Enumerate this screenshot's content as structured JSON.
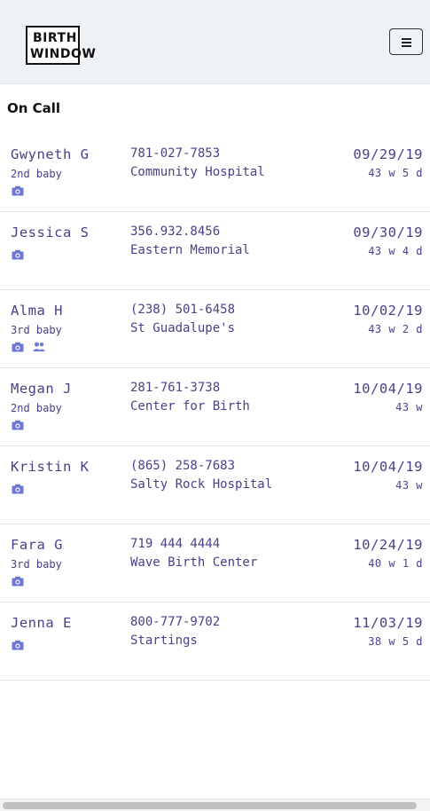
{
  "app": {
    "logo_line1": "BIRTH",
    "logo_line2": "WINDOW"
  },
  "page": {
    "title": "On Call"
  },
  "clients": [
    {
      "name": "Gwyneth G",
      "baby": "2nd baby",
      "phone": "781-027-7853",
      "place": "Community Hospital",
      "date": "09/29/19",
      "weeks": "43 w 5 d",
      "icons": [
        "camera-icon"
      ]
    },
    {
      "name": "Jessica S",
      "baby": "",
      "phone": "356.932.8456",
      "place": "Eastern Memorial",
      "date": "09/30/19",
      "weeks": "43 w 4 d",
      "icons": [
        "camera-icon"
      ]
    },
    {
      "name": "Alma H",
      "baby": "3rd baby",
      "phone": "(238) 501-6458",
      "place": "St Guadalupe's",
      "date": "10/02/19",
      "weeks": "43 w 2 d",
      "icons": [
        "camera-icon",
        "users-icon"
      ]
    },
    {
      "name": "Megan J",
      "baby": "2nd baby",
      "phone": "281-761-3738",
      "place": "Center for Birth",
      "date": "10/04/19",
      "weeks": "43 w",
      "icons": [
        "camera-icon"
      ]
    },
    {
      "name": "Kristin K",
      "baby": "",
      "phone": "(865) 258-7683",
      "place": "Salty Rock Hospital",
      "date": "10/04/19",
      "weeks": "43 w",
      "icons": [
        "camera-icon"
      ]
    },
    {
      "name": "Fara G",
      "baby": "3rd baby",
      "phone": "719 444 4444",
      "place": "Wave Birth Center",
      "date": "10/24/19",
      "weeks": "40 w 1 d",
      "icons": [
        "camera-icon"
      ]
    },
    {
      "name": "Jenna E",
      "baby": "",
      "phone": "800-777-9702",
      "place": "Startings",
      "date": "11/03/19",
      "weeks": "38 w 5 d",
      "icons": [
        "camera-icon"
      ]
    }
  ],
  "colors": {
    "text_primary": "#4b3f8a",
    "icon": "#6b78d8",
    "navbar_bg": "#eef2f6"
  }
}
